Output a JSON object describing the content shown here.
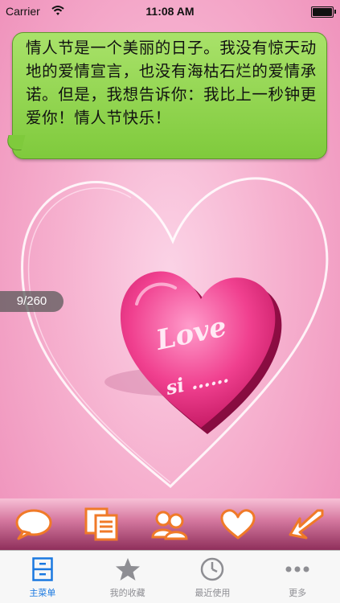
{
  "status_bar": {
    "carrier": "Carrier",
    "time": "11:08 AM"
  },
  "message": {
    "text": "情人节是一个美丽的日子。我没有惊天动地的爱情宣言，也没有海枯石烂的爱情承诺。但是，我想告诉你：我比上一秒钟更爱你！情人节快乐！"
  },
  "art": {
    "word1": "Love",
    "word2": "si ……"
  },
  "counter": {
    "current": 9,
    "total": 260,
    "label": "9/260"
  },
  "toolbar": {
    "items": [
      {
        "icon": "speech-bubble-icon"
      },
      {
        "icon": "copy-documents-icon"
      },
      {
        "icon": "contacts-icon"
      },
      {
        "icon": "heart-icon"
      },
      {
        "icon": "share-arrow-icon"
      }
    ]
  },
  "tab_bar": {
    "tabs": [
      {
        "label": "主菜单",
        "icon": "cabinet-icon",
        "active": true
      },
      {
        "label": "我的收藏",
        "icon": "star-icon",
        "active": false
      },
      {
        "label": "最近使用",
        "icon": "clock-icon",
        "active": false
      },
      {
        "label": "更多",
        "icon": "more-dots-icon",
        "active": false
      }
    ]
  },
  "colors": {
    "bubble": "#8fd24c",
    "accent": "#1a78e0",
    "toolbar_icon": "#f07a28"
  }
}
